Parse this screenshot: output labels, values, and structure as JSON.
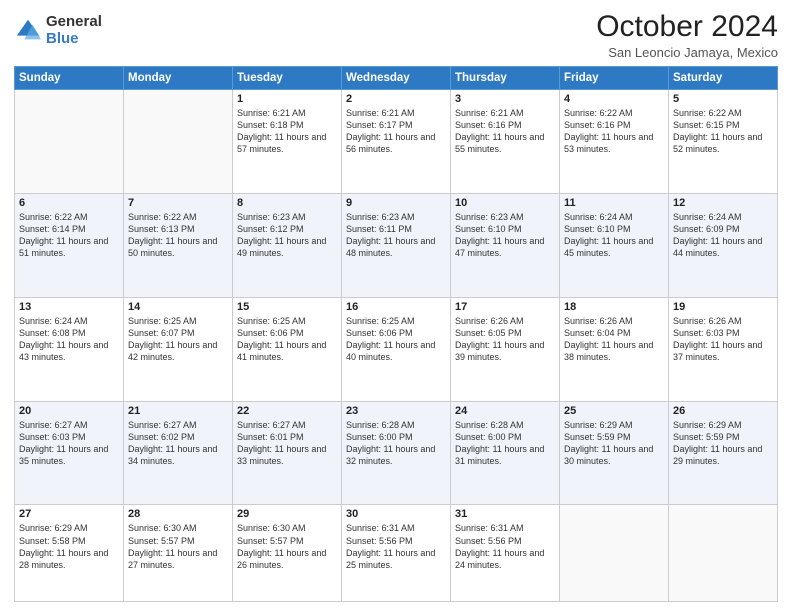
{
  "logo": {
    "general": "General",
    "blue": "Blue"
  },
  "header": {
    "month": "October 2024",
    "location": "San Leoncio Jamaya, Mexico"
  },
  "days_of_week": [
    "Sunday",
    "Monday",
    "Tuesday",
    "Wednesday",
    "Thursday",
    "Friday",
    "Saturday"
  ],
  "weeks": [
    [
      {
        "day": "",
        "info": ""
      },
      {
        "day": "",
        "info": ""
      },
      {
        "day": "1",
        "info": "Sunrise: 6:21 AM\nSunset: 6:18 PM\nDaylight: 11 hours and 57 minutes."
      },
      {
        "day": "2",
        "info": "Sunrise: 6:21 AM\nSunset: 6:17 PM\nDaylight: 11 hours and 56 minutes."
      },
      {
        "day": "3",
        "info": "Sunrise: 6:21 AM\nSunset: 6:16 PM\nDaylight: 11 hours and 55 minutes."
      },
      {
        "day": "4",
        "info": "Sunrise: 6:22 AM\nSunset: 6:16 PM\nDaylight: 11 hours and 53 minutes."
      },
      {
        "day": "5",
        "info": "Sunrise: 6:22 AM\nSunset: 6:15 PM\nDaylight: 11 hours and 52 minutes."
      }
    ],
    [
      {
        "day": "6",
        "info": "Sunrise: 6:22 AM\nSunset: 6:14 PM\nDaylight: 11 hours and 51 minutes."
      },
      {
        "day": "7",
        "info": "Sunrise: 6:22 AM\nSunset: 6:13 PM\nDaylight: 11 hours and 50 minutes."
      },
      {
        "day": "8",
        "info": "Sunrise: 6:23 AM\nSunset: 6:12 PM\nDaylight: 11 hours and 49 minutes."
      },
      {
        "day": "9",
        "info": "Sunrise: 6:23 AM\nSunset: 6:11 PM\nDaylight: 11 hours and 48 minutes."
      },
      {
        "day": "10",
        "info": "Sunrise: 6:23 AM\nSunset: 6:10 PM\nDaylight: 11 hours and 47 minutes."
      },
      {
        "day": "11",
        "info": "Sunrise: 6:24 AM\nSunset: 6:10 PM\nDaylight: 11 hours and 45 minutes."
      },
      {
        "day": "12",
        "info": "Sunrise: 6:24 AM\nSunset: 6:09 PM\nDaylight: 11 hours and 44 minutes."
      }
    ],
    [
      {
        "day": "13",
        "info": "Sunrise: 6:24 AM\nSunset: 6:08 PM\nDaylight: 11 hours and 43 minutes."
      },
      {
        "day": "14",
        "info": "Sunrise: 6:25 AM\nSunset: 6:07 PM\nDaylight: 11 hours and 42 minutes."
      },
      {
        "day": "15",
        "info": "Sunrise: 6:25 AM\nSunset: 6:06 PM\nDaylight: 11 hours and 41 minutes."
      },
      {
        "day": "16",
        "info": "Sunrise: 6:25 AM\nSunset: 6:06 PM\nDaylight: 11 hours and 40 minutes."
      },
      {
        "day": "17",
        "info": "Sunrise: 6:26 AM\nSunset: 6:05 PM\nDaylight: 11 hours and 39 minutes."
      },
      {
        "day": "18",
        "info": "Sunrise: 6:26 AM\nSunset: 6:04 PM\nDaylight: 11 hours and 38 minutes."
      },
      {
        "day": "19",
        "info": "Sunrise: 6:26 AM\nSunset: 6:03 PM\nDaylight: 11 hours and 37 minutes."
      }
    ],
    [
      {
        "day": "20",
        "info": "Sunrise: 6:27 AM\nSunset: 6:03 PM\nDaylight: 11 hours and 35 minutes."
      },
      {
        "day": "21",
        "info": "Sunrise: 6:27 AM\nSunset: 6:02 PM\nDaylight: 11 hours and 34 minutes."
      },
      {
        "day": "22",
        "info": "Sunrise: 6:27 AM\nSunset: 6:01 PM\nDaylight: 11 hours and 33 minutes."
      },
      {
        "day": "23",
        "info": "Sunrise: 6:28 AM\nSunset: 6:00 PM\nDaylight: 11 hours and 32 minutes."
      },
      {
        "day": "24",
        "info": "Sunrise: 6:28 AM\nSunset: 6:00 PM\nDaylight: 11 hours and 31 minutes."
      },
      {
        "day": "25",
        "info": "Sunrise: 6:29 AM\nSunset: 5:59 PM\nDaylight: 11 hours and 30 minutes."
      },
      {
        "day": "26",
        "info": "Sunrise: 6:29 AM\nSunset: 5:59 PM\nDaylight: 11 hours and 29 minutes."
      }
    ],
    [
      {
        "day": "27",
        "info": "Sunrise: 6:29 AM\nSunset: 5:58 PM\nDaylight: 11 hours and 28 minutes."
      },
      {
        "day": "28",
        "info": "Sunrise: 6:30 AM\nSunset: 5:57 PM\nDaylight: 11 hours and 27 minutes."
      },
      {
        "day": "29",
        "info": "Sunrise: 6:30 AM\nSunset: 5:57 PM\nDaylight: 11 hours and 26 minutes."
      },
      {
        "day": "30",
        "info": "Sunrise: 6:31 AM\nSunset: 5:56 PM\nDaylight: 11 hours and 25 minutes."
      },
      {
        "day": "31",
        "info": "Sunrise: 6:31 AM\nSunset: 5:56 PM\nDaylight: 11 hours and 24 minutes."
      },
      {
        "day": "",
        "info": ""
      },
      {
        "day": "",
        "info": ""
      }
    ]
  ]
}
